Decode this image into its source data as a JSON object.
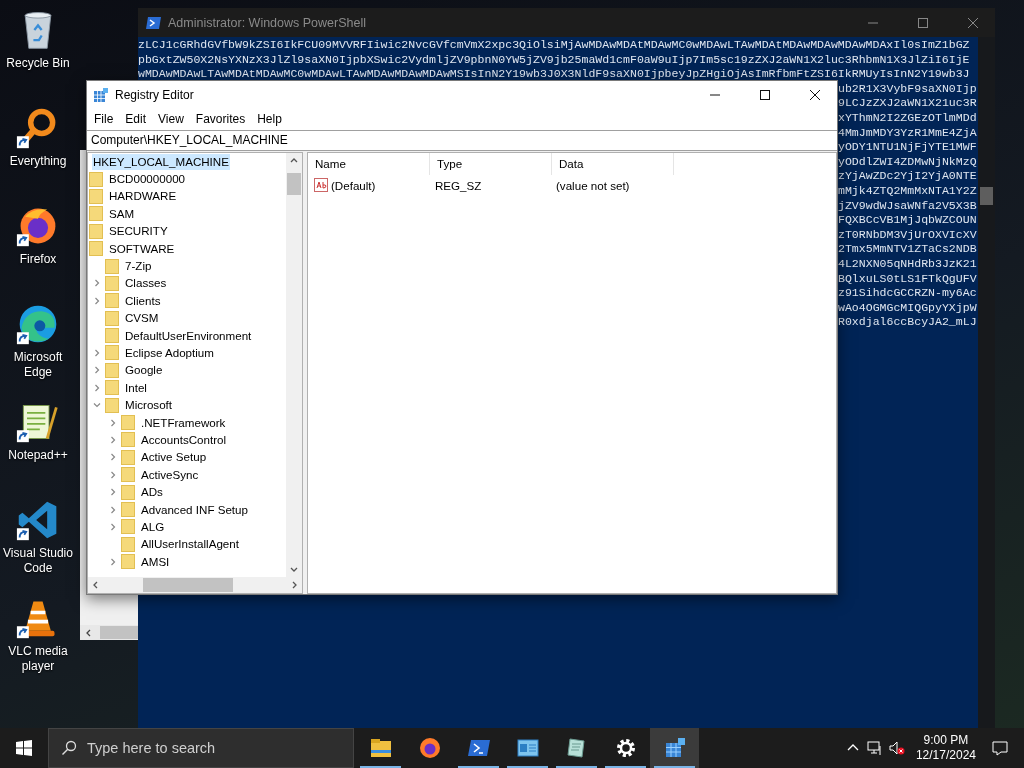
{
  "desktop_icons": [
    {
      "label": "Recycle Bin",
      "kind": "recycle-bin",
      "shortcut": false
    },
    {
      "label": "Everything",
      "kind": "magnifier",
      "shortcut": true
    },
    {
      "label": "Firefox",
      "kind": "firefox",
      "shortcut": true
    },
    {
      "label": "Microsoft Edge",
      "kind": "edge",
      "shortcut": true
    },
    {
      "label": "Notepad++",
      "kind": "notepad",
      "shortcut": true
    },
    {
      "label": "Visual Studio Code",
      "kind": "vscode",
      "shortcut": true
    },
    {
      "label": "VLC media player",
      "kind": "cone",
      "shortcut": true
    }
  ],
  "powershell": {
    "title": "Administrator: Windows PowerShell",
    "lines": [
      "zLCJ1cGRhdGVfbW9kZSI6IkFCU09MVVRFIiwic2NvcGVfcmVmX2xpc3QiOlsiMjAwMDAwMDAtMDAwMC0wMDAwLTAwMDAtMDAwMDAwMDAwMDAxIl0sImZ1bGZ",
      "pbGxtZW50X2NsYXNzX3JlZl9saXN0IjpbXSwic2VydmljZV9pbnN0YW5jZV9jb25maWd1cmF0aW9uIjp7Im5sc19zZXJ2aWN1X2luc3RhbmN1X3JlZiI6IjE",
      "wMDAwMDAwLTAwMDAtMDAwMC0wMDAwLTAwMDAwMDAwMDAwMSIsInN2Y19wb3J0X3NldF9saXN0IjpbeyJpZHgiOjAsImRfbmFtZSI6IkRMUyIsInN2Y19wb3J"
    ],
    "partial_lines": [
      "ub2R1X3VybF9saXN0Ijp",
      "9LCJzZXJ2aWN1X21uc3R",
      "xYThmN2I2ZGEzOTlmMDd",
      "4MmJmMDY3YzR1MmE4ZjA",
      "yODY1NTU1NjFjYTE1MWF",
      "yODdlZWI4ZDMwNjNkMzQ",
      "zYjAwZDc2YjI2YjA0NTE",
      "mMjk4ZTQ2MmMxNTA1Y2Z",
      "jZV9wdWJsaWNfa2V5X3B",
      "FQXBCcVB1MjJqbWZCOUN",
      "zT0RNbDM3VjUrOXVIcXV",
      "2Tmx5MmNTV1ZTaCs2NDB",
      "4L2NXN05qNHdRb3JzK21",
      "BQlxuLS0tLS1FTkQgUFV",
      "z91SihdcGCCRZN-my6Ac",
      "wAo4OGMGcMIQGpyYXjpW",
      "R0xdjal6ccBcyJA2_mLJ"
    ]
  },
  "registry_editor": {
    "title": "Registry Editor",
    "menu": [
      "File",
      "Edit",
      "View",
      "Favorites",
      "Help"
    ],
    "address": "Computer\\HKEY_LOCAL_MACHINE",
    "tree": [
      {
        "label": "HKEY_LOCAL_MACHINE",
        "selected": true,
        "children": [
          {
            "label": "BCD00000000",
            "selected": false
          },
          {
            "label": "HARDWARE",
            "selected": false
          },
          {
            "label": "SAM",
            "selected": false
          },
          {
            "label": "SECURITY",
            "selected": false
          },
          {
            "label": "SOFTWARE",
            "selected": false,
            "children": [
              {
                "label": "7-Zip",
                "selected": false
              },
              {
                "label": "Classes",
                "selected": false,
                "expanded": false
              },
              {
                "label": "Clients",
                "selected": false,
                "expanded": false
              },
              {
                "label": "CVSM",
                "selected": false
              },
              {
                "label": "DefaultUserEnvironment",
                "selected": false
              },
              {
                "label": "Eclipse Adoptium",
                "selected": false,
                "expanded": false
              },
              {
                "label": "Google",
                "selected": false,
                "expanded": false
              },
              {
                "label": "Intel",
                "selected": false,
                "expanded": false
              },
              {
                "label": "Microsoft",
                "selected": false,
                "expanded": true,
                "children": [
                  {
                    "label": ".NETFramework",
                    "selected": false,
                    "expanded": false
                  },
                  {
                    "label": "AccountsControl",
                    "selected": false,
                    "expanded": false
                  },
                  {
                    "label": "Active Setup",
                    "selected": false,
                    "expanded": false
                  },
                  {
                    "label": "ActiveSync",
                    "selected": false,
                    "expanded": false
                  },
                  {
                    "label": "ADs",
                    "selected": false,
                    "expanded": false
                  },
                  {
                    "label": "Advanced INF Setup",
                    "selected": false,
                    "expanded": false
                  },
                  {
                    "label": "ALG",
                    "selected": false,
                    "expanded": false
                  },
                  {
                    "label": "AllUserInstallAgent",
                    "selected": false
                  },
                  {
                    "label": "AMSI",
                    "selected": false,
                    "expanded": false
                  }
                ]
              }
            ]
          }
        ]
      }
    ],
    "columns": [
      "Name",
      "Type",
      "Data"
    ],
    "values": [
      {
        "name": "(Default)",
        "type": "REG_SZ",
        "data": "(value not set)"
      }
    ]
  },
  "taskbar": {
    "search_placeholder": "Type here to search",
    "apps": [
      {
        "kind": "folder",
        "running": true,
        "active": false
      },
      {
        "kind": "firefox",
        "running": false,
        "active": false
      },
      {
        "kind": "terminal",
        "running": true,
        "active": false
      },
      {
        "kind": "window",
        "running": true,
        "active": false
      },
      {
        "kind": "notepad",
        "running": true,
        "active": false
      },
      {
        "kind": "gear",
        "running": true,
        "active": false
      },
      {
        "kind": "registry",
        "running": true,
        "active": true
      }
    ],
    "time": "9:00 PM",
    "date": "12/17/2024"
  }
}
